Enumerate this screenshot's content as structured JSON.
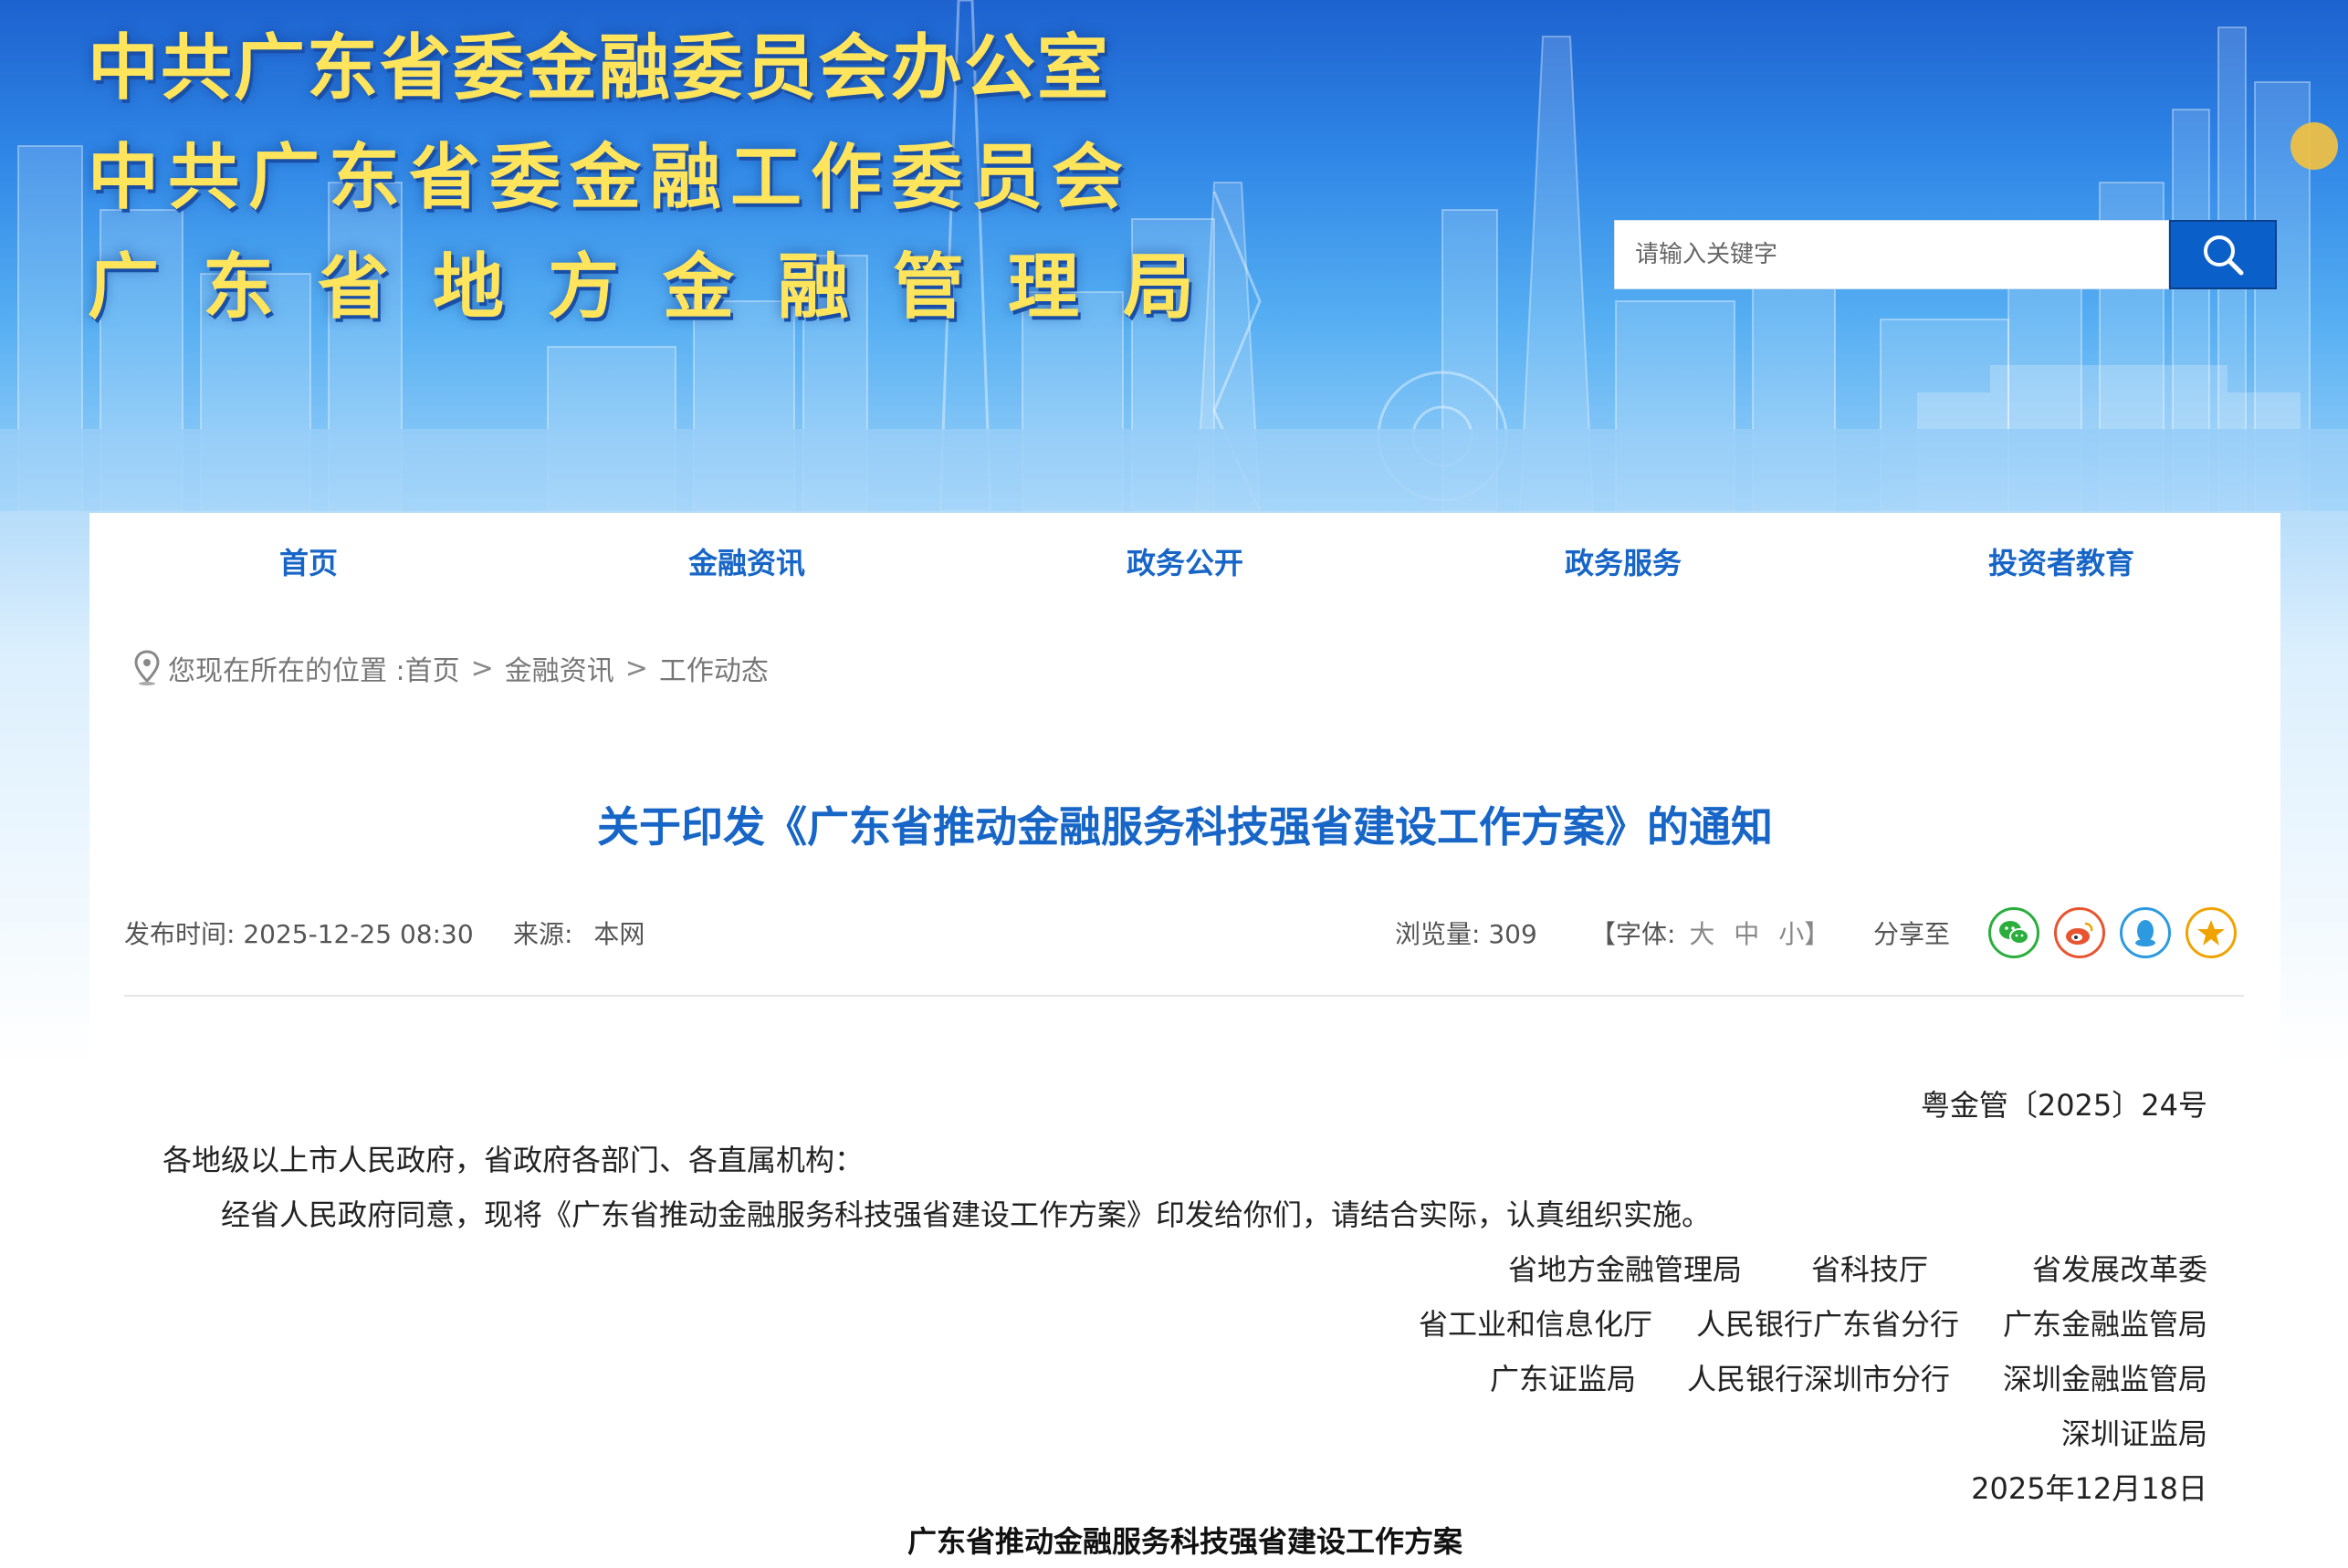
{
  "header": {
    "title_line_1": "中共广东省委金融委员会办公室",
    "title_line_2": "中共广东省委金融工作委员会",
    "title_line_3": "广东省地方金融管理局"
  },
  "search": {
    "placeholder": "请输入关键字",
    "icon": "search-icon"
  },
  "nav": {
    "items": [
      {
        "label": "首页"
      },
      {
        "label": "金融资讯"
      },
      {
        "label": "政务公开"
      },
      {
        "label": "政务服务"
      },
      {
        "label": "投资者教育"
      }
    ]
  },
  "breadcrumb": {
    "icon": "location-pin-icon",
    "prefix": "您现在所在的位置 : ",
    "items": [
      "首页",
      "金融资讯",
      "工作动态"
    ],
    "separator": ">"
  },
  "article": {
    "title": "关于印发《广东省推动金融服务科技强省建设工作方案》的通知",
    "publish_label": "发布时间:",
    "publish_time": "2025-12-25 08:30",
    "source_label": "来源:",
    "source": "本网",
    "views_label": "浏览量:",
    "views": "309",
    "font_label": "【字体:",
    "font_large": "大",
    "font_medium": "中",
    "font_small": "小】",
    "share_label": "分享至",
    "share_icons": [
      "wechat-icon",
      "weibo-icon",
      "qq-icon",
      "favorite-star-icon"
    ],
    "doc_number": "粤金管〔2025〕24号",
    "salutation": "各地级以上市人民政府，省政府各部门、各直属机构：",
    "paragraph": "经省人民政府同意，现将《广东省推动金融服务科技强省建设工作方案》印发给你们，请结合实际，认真组织实施。",
    "signatories": {
      "row1": [
        "省地方金融管理局",
        "省科技厅",
        "省发展改革委"
      ],
      "row2": [
        "省工业和信息化厅",
        "人民银行广东省分行",
        "广东金融监管局"
      ],
      "row3": [
        "广东证监局",
        "人民银行深圳市分行",
        "深圳金融监管局"
      ],
      "row4": [
        "深圳证监局"
      ]
    },
    "date": "2025年12月18日",
    "doc_heading": "广东省推动金融服务科技强省建设工作方案"
  },
  "colors": {
    "brand_blue": "#1766c7",
    "title_yellow": "#ffe45c",
    "wechat": "#2aae3c",
    "weibo": "#e8542f",
    "qq": "#2d9ae0",
    "star": "#f0a300"
  }
}
